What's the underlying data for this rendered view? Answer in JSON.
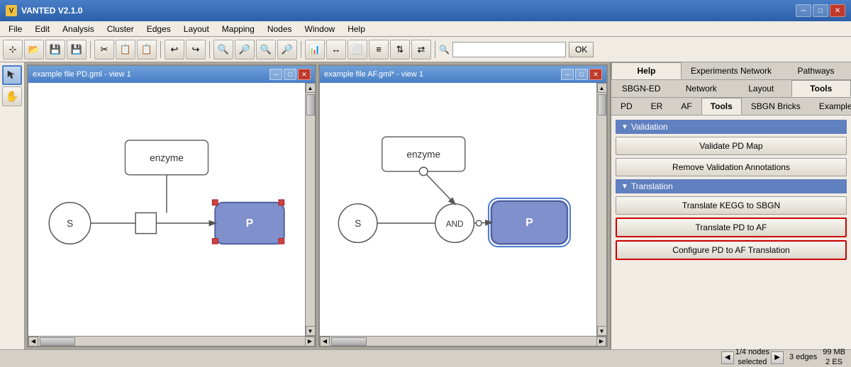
{
  "app": {
    "title": "VANTED V2.1.0",
    "icon": "V"
  },
  "titlebar": {
    "minimize": "─",
    "maximize": "□",
    "close": "✕"
  },
  "menu": {
    "items": [
      "File",
      "Edit",
      "Analysis",
      "Cluster",
      "Edges",
      "Layout",
      "Mapping",
      "Nodes",
      "Window",
      "Help"
    ]
  },
  "toolbar": {
    "search_placeholder": "",
    "search_ok": "OK",
    "buttons": [
      "🔍",
      "💾",
      "💾",
      "📋",
      "✂",
      "📋",
      "🗑",
      "↩",
      "↪",
      "🔍",
      "🔎",
      "🔍",
      "🔎",
      "📊",
      "↔",
      "⬜",
      "≡",
      "⇅",
      "⇄"
    ]
  },
  "left_sidebar": {
    "buttons": [
      "↖",
      "✋"
    ]
  },
  "doc_windows": [
    {
      "id": "doc1",
      "title": "example file PD.gml - view 1"
    },
    {
      "id": "doc2",
      "title": "example file AF.gml* - view 1"
    }
  ],
  "right_panel": {
    "tab_row1": [
      "Help",
      "Experiments Network",
      "Pathways"
    ],
    "tab_row2": [
      "SBGN-ED",
      "Network",
      "Layout",
      "Tools"
    ],
    "tab_row3": [
      "PD",
      "ER",
      "AF",
      "Tools",
      "SBGN Bricks",
      "Examples"
    ],
    "active_tab_row1": "Help",
    "active_tab_row2": "Tools",
    "active_tab_row3": "Tools",
    "sections": [
      {
        "id": "validation",
        "label": "Validation",
        "buttons": [
          {
            "id": "validate-pd",
            "label": "Validate PD Map",
            "highlighted": false
          },
          {
            "id": "remove-validation",
            "label": "Remove Validation Annotations",
            "highlighted": false
          }
        ]
      },
      {
        "id": "translation",
        "label": "Translation",
        "buttons": [
          {
            "id": "translate-kegg",
            "label": "Translate KEGG to SBGN",
            "highlighted": false
          },
          {
            "id": "translate-pd-af",
            "label": "Translate PD to AF",
            "highlighted": true
          },
          {
            "id": "configure-pd-af",
            "label": "Configure PD to AF Translation",
            "highlighted": true
          }
        ]
      }
    ]
  },
  "status_bar": {
    "nav_prev": "◀",
    "nav_next": "▶",
    "nodes_info": "1/4 nodes\nselected",
    "edges_info": "3 edges",
    "memory_info": "99 MB\n2 ES"
  }
}
